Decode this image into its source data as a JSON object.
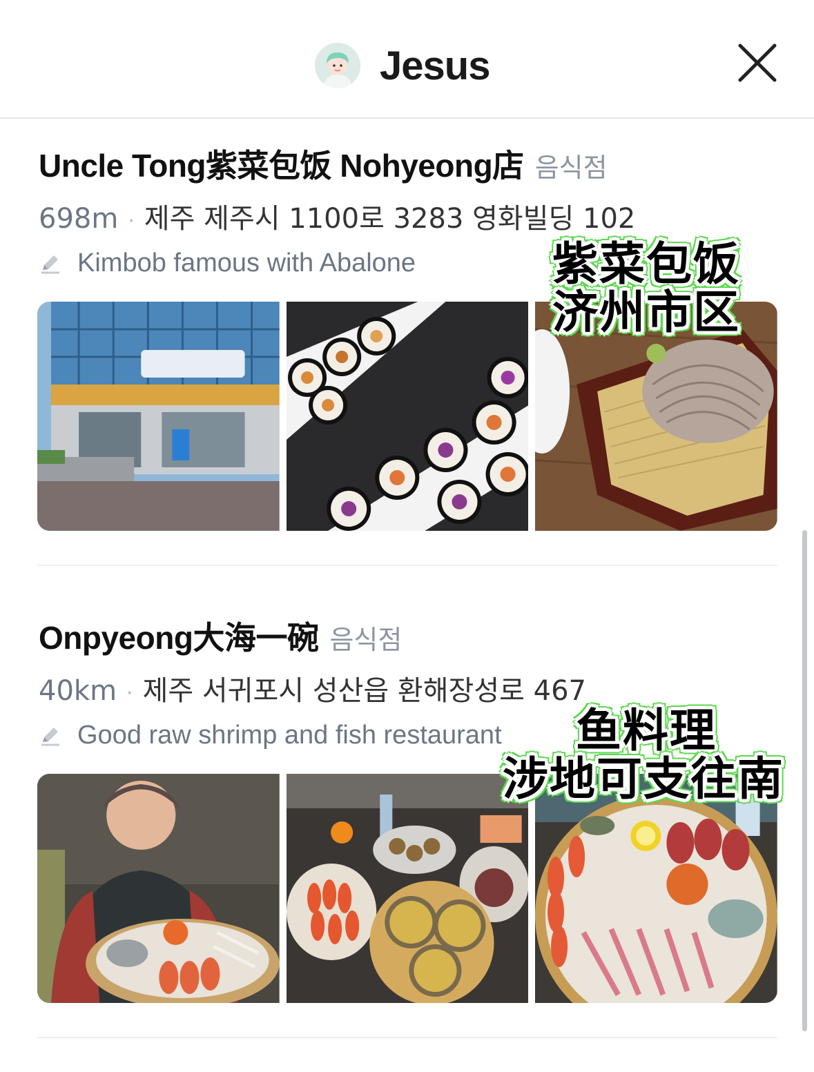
{
  "header": {
    "user_name": "Jesus",
    "avatar_icon": "avatar-illustration",
    "close_icon": "close-icon"
  },
  "places": [
    {
      "name": "Uncle Tong紫菜包饭 Nohyeong店",
      "category": "음식점",
      "distance": "698m",
      "separator": "·",
      "address": "제주 제주시 1100로 3283 영화빌딩 102",
      "memo_icon": "pencil-icon",
      "memo": "Kimbob famous with Abalone",
      "overlay_lines": [
        "紫菜包饭",
        "济州市区"
      ],
      "photos": [
        "storefront-photo",
        "kimbap-rolls-photo",
        "soba-noodles-photo"
      ]
    },
    {
      "name": "Onpyeong大海一碗",
      "category": "음식점",
      "distance": "40km",
      "separator": "·",
      "address": "제주 서귀포시 성산읍 환해장성로 467",
      "memo_icon": "pencil-icon",
      "memo": "Good raw shrimp and fish restaurant",
      "overlay_lines": [
        "鱼料理",
        "涉地可支往南"
      ],
      "photos": [
        "grandma-seafood-platter-photo",
        "seafood-spread-photo",
        "sashimi-platter-photo"
      ]
    }
  ],
  "colors": {
    "accent_overlay_outline": "#5ad84c",
    "secondary_text": "#6b7684",
    "category_text": "#8b95a1",
    "divider": "#eef0f2"
  }
}
